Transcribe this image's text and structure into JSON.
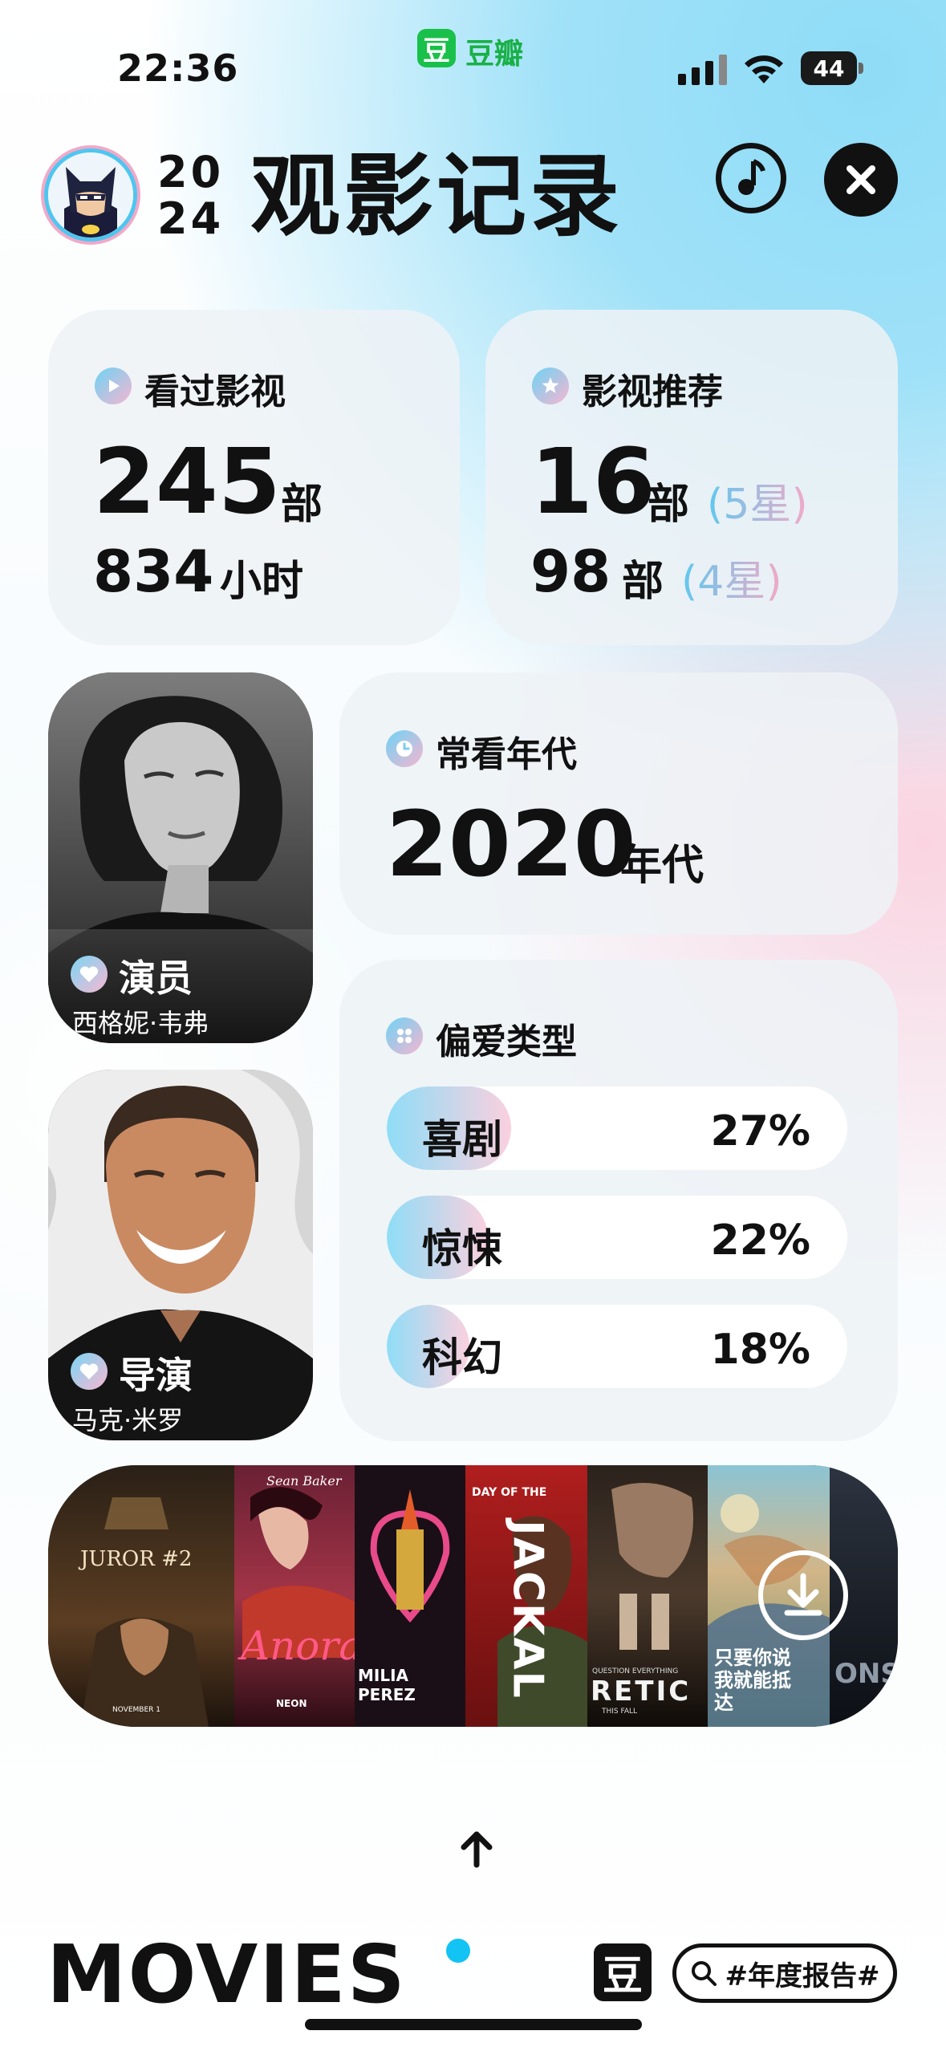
{
  "status_bar": {
    "time": "22:36",
    "app_badge": "豆",
    "app_name": "豆瓣",
    "battery": "44"
  },
  "header": {
    "year_line1": "20",
    "year_line2": "24",
    "title": "观影记录"
  },
  "watched": {
    "label": "看过影视",
    "count": "245",
    "count_unit": "部",
    "hours": "834",
    "hours_unit": "小时"
  },
  "recommend": {
    "label": "影视推荐",
    "five_star_count": "16",
    "five_star_unit": "部",
    "five_star_note": "(5星)",
    "four_star_count": "98",
    "four_star_unit": "部",
    "four_star_note": "(4星)"
  },
  "decade": {
    "label": "常看年代",
    "value": "2020",
    "unit": "年代"
  },
  "actor": {
    "role": "演员",
    "name": "西格妮·韦弗"
  },
  "director": {
    "role": "导演",
    "name": "马克·米罗"
  },
  "genres": {
    "label": "偏爱类型",
    "items": [
      {
        "name": "喜剧",
        "pct": "27%",
        "fraction": 0.27
      },
      {
        "name": "惊悚",
        "pct": "22%",
        "fraction": 0.22
      },
      {
        "name": "科幻",
        "pct": "18%",
        "fraction": 0.18
      }
    ]
  },
  "posters": {
    "juror": {
      "title": "JUROR #2",
      "date": "NOVEMBER 1"
    },
    "anora": {
      "director": "Sean Baker",
      "title": "Anora",
      "studio": "NEON"
    },
    "emilia": {
      "title": "MILIA PEREZ"
    },
    "jackal": {
      "top": "DAY OF THE",
      "title": "JACKAL"
    },
    "heretic": {
      "title": "RETIC",
      "tagline": "QUESTION EVERYTHING",
      "date": "THIS FALL"
    },
    "anime": {
      "title": "只要你说 我就能抵达"
    },
    "last": {
      "title": "ONS"
    }
  },
  "icons": {
    "music": "music-note-icon",
    "close": "close-icon",
    "download": "download-icon",
    "up": "arrow-up-icon",
    "search": "search-icon"
  },
  "footer": {
    "brand": "MOVIES",
    "logo": "豆",
    "tag": "#年度报告#"
  },
  "colors": {
    "accent_blue": "#5fc8ef",
    "accent_pink": "#f4a9c7",
    "brand_dot": "#12c3f4",
    "douban_green": "#19c04a"
  }
}
